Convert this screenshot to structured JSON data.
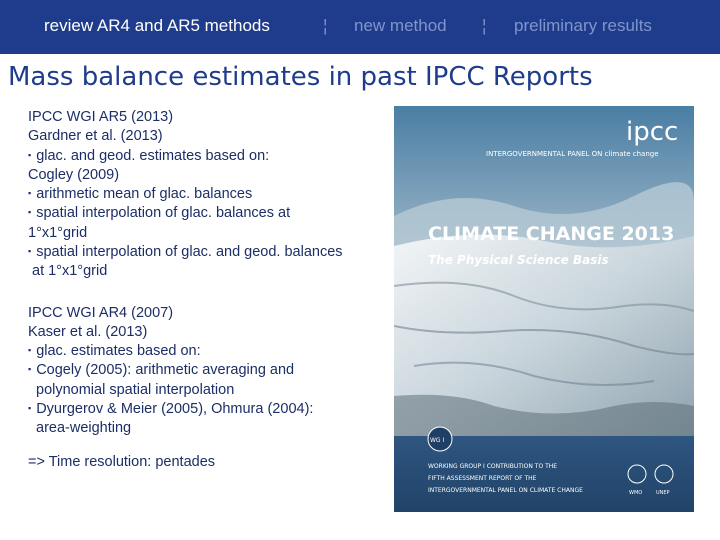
{
  "nav": {
    "items": [
      {
        "label": "review AR4 and AR5 methods",
        "active": true
      },
      {
        "label": "new method",
        "active": false
      },
      {
        "label": "preliminary results",
        "active": false
      }
    ],
    "separator": "¦"
  },
  "title": "Mass balance estimates in past IPCC Reports",
  "ar5": {
    "heading": "IPCC WGI AR5 (2013)",
    "subheading": "Gardner et al. (2013)",
    "bullet1": "glac. and geod. estimates based on:",
    "cogley": "Cogley (2009)",
    "cogley_bullets": [
      "arithmetic mean of glac. balances",
      "spatial interpolation of glac. balances at",
      "1°x1°grid",
      "spatial interpolation of glac. and geod. balances",
      "at 1°x1°grid"
    ]
  },
  "ar4": {
    "heading": "IPCC WGI AR4 (2007)",
    "subheading": "Kaser et al. (2013)",
    "bullets": [
      "glac. estimates based on:",
      "Cogely (2005): arithmetic averaging and",
      "polynomial spatial interpolation",
      "Dyurgerov & Meier (2005), Ohmura (2004):",
      "area-weighting"
    ]
  },
  "conclusion": "=> Time resolution: pentades",
  "cover": {
    "logo": "ipcc",
    "panel": "INTERGOVERNMENTAL PANEL ON climate change",
    "title": "CLIMATE CHANGE 2013",
    "subtitle": "The Physical Science Basis",
    "badge": "WG I",
    "footer_lines": [
      "WORKING GROUP I CONTRIBUTION TO THE",
      "FIFTH ASSESSMENT REPORT OF THE",
      "INTERGOVERNMENTAL PANEL ON CLIMATE CHANGE"
    ],
    "wmo": "WMO",
    "unep": "UNEP",
    "colors": {
      "sky": "#3d6f96",
      "panel": "#2a4f78",
      "ice": "#e4ecf0"
    }
  }
}
